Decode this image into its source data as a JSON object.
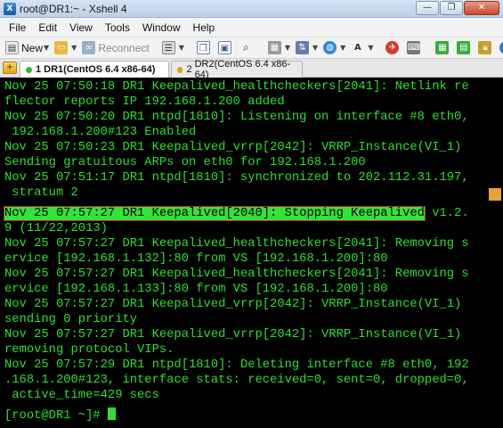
{
  "window": {
    "title": "root@DR1:~ - Xshell 4",
    "controls": [
      "—",
      "❐",
      "✕"
    ]
  },
  "menu": [
    "File",
    "Edit",
    "View",
    "Tools",
    "Window",
    "Help"
  ],
  "toolbar": {
    "new_label": "New",
    "reconnect_label": "Reconnect"
  },
  "tabs": [
    {
      "num": "1",
      "label": "DR1(CentOS 6.4  x86-64)",
      "active": true
    },
    {
      "num": "2",
      "label": "DR2(CentOS 6.4  x86-64)",
      "active": false
    }
  ],
  "terminal": {
    "lines": [
      "Nov 25 07:50:18 DR1 Keepalived_healthcheckers[2041]: Netlink re",
      "flector reports IP 192.168.1.200 added",
      "Nov 25 07:50:20 DR1 ntpd[1810]: Listening on interface #8 eth0,",
      " 192.168.1.200#123 Enabled",
      "Nov 25 07:50:23 DR1 Keepalived_vrrp[2042]: VRRP_Instance(VI_1)",
      "Sending gratuitous ARPs on eth0 for 192.168.1.200",
      "Nov 25 07:51:17 DR1 ntpd[1810]: synchronized to 202.112.31.197,",
      " stratum 2"
    ],
    "highlight": {
      "text": "Nov 25 07:57:27 DR1 Keepalived[2040]: Stopping Keepalived",
      "rest": " v1.2."
    },
    "lines_after": [
      "9 (11/22,2013)",
      "Nov 25 07:57:27 DR1 Keepalived_healthcheckers[2041]: Removing s",
      "ervice [192.168.1.132]:80 from VS [192.168.1.200]:80",
      "Nov 25 07:57:27 DR1 Keepalived_healthcheckers[2041]: Removing s",
      "ervice [192.168.1.133]:80 from VS [192.168.1.200]:80",
      "Nov 25 07:57:27 DR1 Keepalived_vrrp[2042]: VRRP_Instance(VI_1)",
      "sending 0 priority",
      "Nov 25 07:57:27 DR1 Keepalived_vrrp[2042]: VRRP_Instance(VI_1)",
      "removing protocol VIPs.",
      "Nov 25 07:57:29 DR1 ntpd[1810]: Deleting interface #8 eth0, 192",
      ".168.1.200#123, interface stats: received=0, sent=0, dropped=0,",
      " active_time=429 secs"
    ],
    "prompt": "[root@DR1 ~]# "
  }
}
